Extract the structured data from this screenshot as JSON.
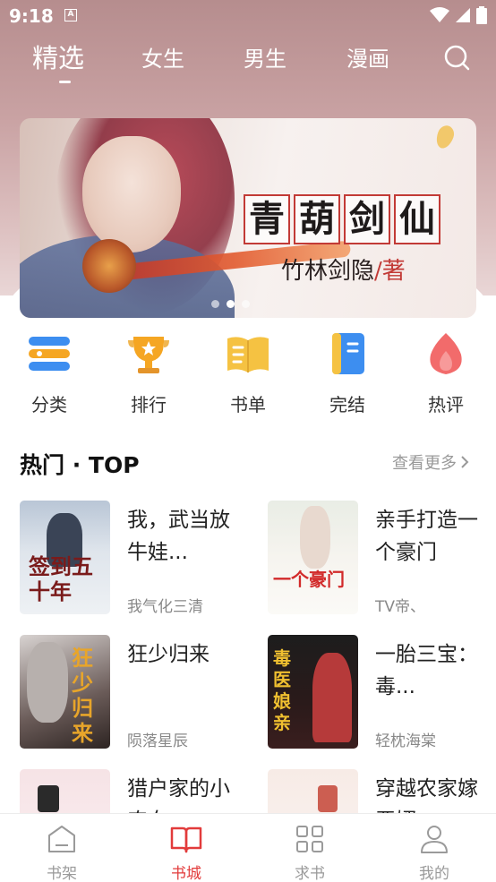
{
  "status_bar": {
    "time": "9:18",
    "badge": "A"
  },
  "top_nav": {
    "tabs": [
      {
        "label": "精选",
        "active": true
      },
      {
        "label": "女生",
        "active": false
      },
      {
        "label": "男生",
        "active": false
      },
      {
        "label": "漫画",
        "active": false
      }
    ],
    "search_icon": "search-icon"
  },
  "banner": {
    "title_chars": [
      "青",
      "葫",
      "剑",
      "仙"
    ],
    "author": "竹林剑隐",
    "author_suffix": "/著",
    "slide_count": 3,
    "active_slide": 2
  },
  "categories": [
    {
      "label": "分类",
      "icon": "list-icon",
      "color": "#3d8ef0"
    },
    {
      "label": "排行",
      "icon": "trophy-icon",
      "color": "#f5a623"
    },
    {
      "label": "书单",
      "icon": "book-open-icon",
      "color": "#f5c242"
    },
    {
      "label": "完结",
      "icon": "notebook-icon",
      "color": "#3d8ef0"
    },
    {
      "label": "热评",
      "icon": "flame-icon",
      "color": "#f26b6b"
    }
  ],
  "hot_section": {
    "title": "热门 · TOP",
    "see_more": "查看更多"
  },
  "books": [
    {
      "title": "我，武当放牛娃...",
      "author": "我气化三清",
      "cover_text": "签到五十年"
    },
    {
      "title": "亲手打造一个豪门",
      "author": "TV帝、",
      "cover_text": "一个豪门"
    },
    {
      "title": "狂少归来",
      "author": "陨落星辰",
      "cover_text": "狂少归来"
    },
    {
      "title": "一胎三宝：毒...",
      "author": "轻枕海棠",
      "cover_text": "毒医娘亲"
    },
    {
      "title": "猎户家的小农女",
      "author": "",
      "cover_text": ""
    },
    {
      "title": "穿越农家嫁恶婿",
      "author": "",
      "cover_text": ""
    }
  ],
  "bottom_nav": [
    {
      "label": "书架",
      "icon": "bookshelf-icon",
      "active": false
    },
    {
      "label": "书城",
      "icon": "book-store-icon",
      "active": true
    },
    {
      "label": "求书",
      "icon": "grid-icon",
      "active": false
    },
    {
      "label": "我的",
      "icon": "user-icon",
      "active": false
    }
  ],
  "colors": {
    "accent": "#e23b3b",
    "header": "#c9a2a3"
  }
}
